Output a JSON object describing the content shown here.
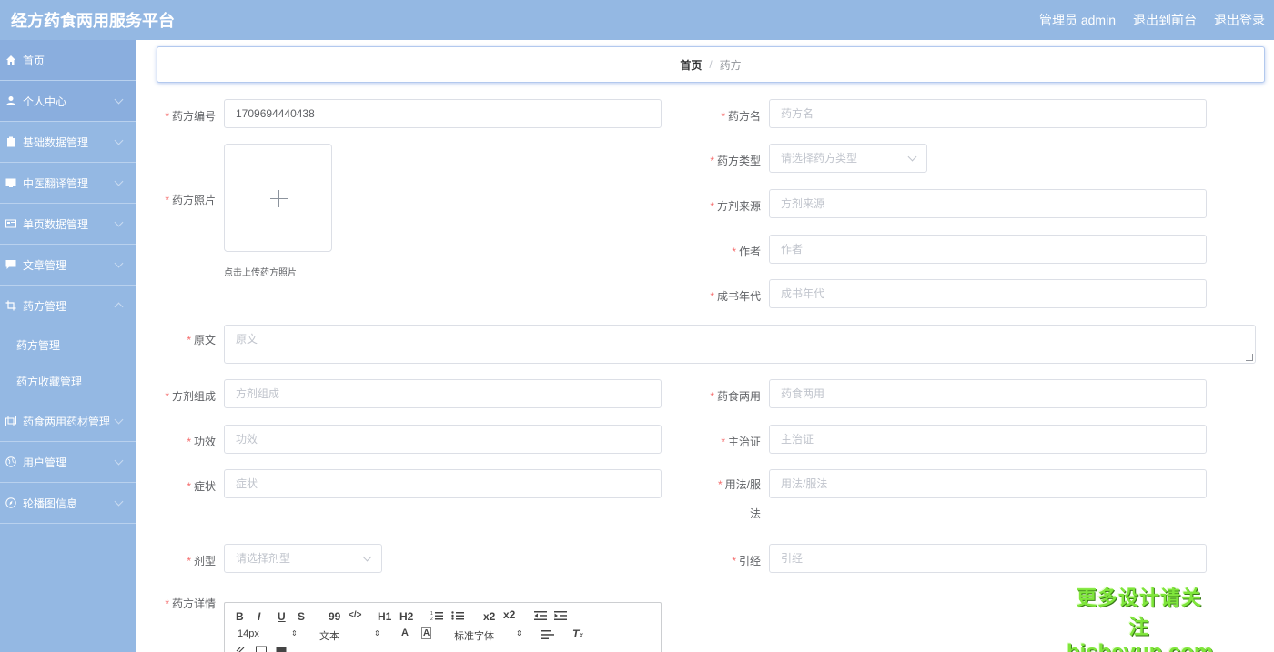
{
  "header": {
    "title": "经方药食两用服务平台",
    "user": "管理员 admin",
    "front": "退出到前台",
    "logout": "退出登录"
  },
  "sidebar": {
    "items": [
      {
        "label": "首页",
        "icon": "home-icon"
      },
      {
        "label": "个人中心",
        "icon": "user-icon"
      },
      {
        "label": "基础数据管理",
        "icon": "clipboard-icon"
      },
      {
        "label": "中医翻译管理",
        "icon": "monitor-icon"
      },
      {
        "label": "单页数据管理",
        "icon": "card-icon"
      },
      {
        "label": "文章管理",
        "icon": "chat-icon"
      },
      {
        "label": "药方管理",
        "icon": "crop-icon"
      },
      {
        "label": "药食两用药材管理",
        "icon": "copy-icon"
      },
      {
        "label": "用户管理",
        "icon": "globe-icon"
      },
      {
        "label": "轮播图信息",
        "icon": "compass-icon"
      }
    ],
    "submenu": [
      "药方管理",
      "药方收藏管理"
    ]
  },
  "breadcrumb": {
    "home": "首页",
    "sep": "/",
    "current": "药方"
  },
  "form": {
    "bianhao": {
      "label": "药方编号",
      "value": "1709694440438"
    },
    "ming": {
      "label": "药方名",
      "placeholder": "药方名"
    },
    "leixing": {
      "label": "药方类型",
      "placeholder": "请选择药方类型"
    },
    "zhaopian": {
      "label": "药方照片",
      "tip": "点击上传药方照片"
    },
    "laiyuan": {
      "label": "方剂来源",
      "placeholder": "方剂来源"
    },
    "zuozhe": {
      "label": "作者",
      "placeholder": "作者"
    },
    "niandai": {
      "label": "成书年代",
      "placeholder": "成书年代"
    },
    "yuanwen": {
      "label": "原文",
      "placeholder": "原文"
    },
    "zucheng": {
      "label": "方剂组成",
      "placeholder": "方剂组成"
    },
    "liangyong": {
      "label": "药食两用",
      "placeholder": "药食两用"
    },
    "gongxiao": {
      "label": "功效",
      "placeholder": "功效"
    },
    "zhuzhi": {
      "label": "主治证",
      "placeholder": "主治证"
    },
    "zhengzhuang": {
      "label": "症状",
      "placeholder": "症状"
    },
    "yongfa": {
      "label_line1": "用法/服",
      "label_line2": "法",
      "placeholder": "用法/服法"
    },
    "jixing": {
      "label": "剂型",
      "placeholder": "请选择剂型"
    },
    "yinjing": {
      "label": "引经",
      "placeholder": "引经"
    },
    "xiangqing": {
      "label": "药方详情"
    }
  },
  "editor": {
    "font_size": "14px",
    "format": "文本",
    "font_family": "标准字体",
    "buttons": [
      "B",
      "I",
      "U",
      "S",
      "99",
      "</>",
      "H1",
      "H2",
      "ol",
      "ul",
      "x2",
      "x2",
      "outdent",
      "indent"
    ]
  },
  "watermark": {
    "line1": "更多设计请关注",
    "line2": "bisheyun.com"
  }
}
